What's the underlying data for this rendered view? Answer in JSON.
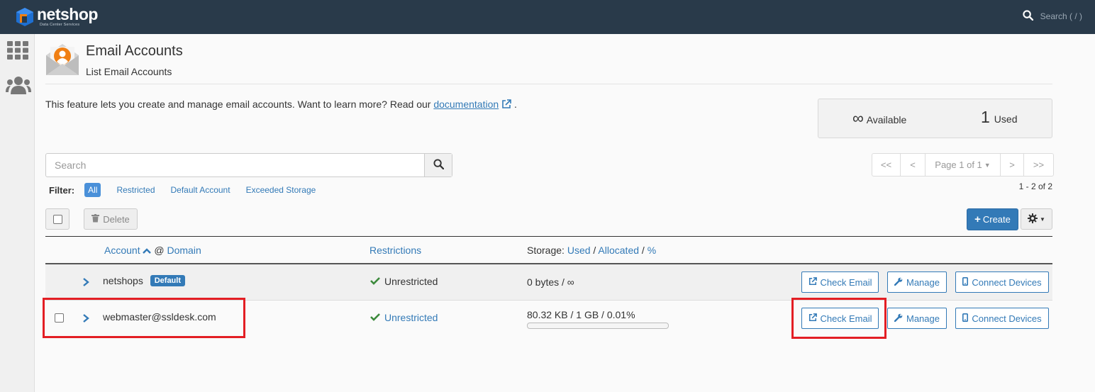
{
  "topbar": {
    "brand": "netshop",
    "brand_sub": "Data Center Services",
    "search_placeholder": "Search ( / )"
  },
  "header": {
    "title": "Email Accounts",
    "subtitle": "List Email Accounts"
  },
  "intro": {
    "text": "This feature lets you create and manage email accounts. Want to learn more? Read our ",
    "link": "documentation",
    "end": "."
  },
  "stats": {
    "available_value": "∞",
    "available_label": "Available",
    "used_value": "1",
    "used_label": "Used"
  },
  "search": {
    "placeholder": "Search"
  },
  "filter": {
    "label": "Filter:",
    "options": [
      "All",
      "Restricted",
      "Default Account",
      "Exceeded Storage"
    ]
  },
  "pager": {
    "first": "<<",
    "prev": "<",
    "page": "Page 1 of 1",
    "next": ">",
    "last": ">>",
    "count": "1 - 2 of 2"
  },
  "toolbar": {
    "delete_label": "Delete",
    "create_label": "Create"
  },
  "table": {
    "col_account": "Account",
    "col_at": "@",
    "col_domain": "Domain",
    "col_restrictions": "Restrictions",
    "col_storage_prefix": "Storage:",
    "col_storage_used": "Used",
    "col_storage_sep1": "/",
    "col_storage_alloc": "Allocated",
    "col_storage_sep2": "/",
    "col_storage_pct": "%",
    "rows": [
      {
        "account": "netshops",
        "badge": "Default",
        "restriction": "Unrestricted",
        "storage": "0 bytes / ∞"
      },
      {
        "account": "webmaster@ssldesk.com",
        "restriction": "Unrestricted",
        "storage": "80.32 KB / 1 GB / 0.01%",
        "storage_fraction": 0.0001
      }
    ],
    "actions": {
      "check_email": "Check Email",
      "manage": "Manage",
      "connect_devices": "Connect Devices"
    }
  },
  "colors": {
    "topbar": "#293a4a",
    "accent": "#337ab7",
    "highlight": "#e31e24",
    "check": "#3c8a3c"
  }
}
